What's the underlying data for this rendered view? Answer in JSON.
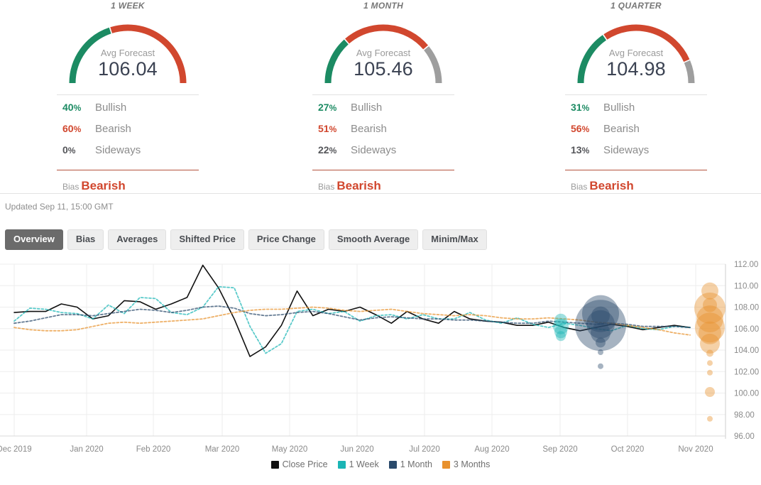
{
  "panels": [
    {
      "title": "1 WEEK",
      "gauge_label": "Avg Forecast",
      "gauge_value": "106.04",
      "bullish": "40",
      "bearish": "60",
      "sideways": "0",
      "bullish_label": "Bullish",
      "bearish_label": "Bearish",
      "sideways_label": "Sideways",
      "bias_label": "Bias",
      "bias_value": "Bearish"
    },
    {
      "title": "1 MONTH",
      "gauge_label": "Avg Forecast",
      "gauge_value": "105.46",
      "bullish": "27",
      "bearish": "51",
      "sideways": "22",
      "bullish_label": "Bullish",
      "bearish_label": "Bearish",
      "sideways_label": "Sideways",
      "bias_label": "Bias",
      "bias_value": "Bearish"
    },
    {
      "title": "1 QUARTER",
      "gauge_label": "Avg Forecast",
      "gauge_value": "104.98",
      "bullish": "31",
      "bearish": "56",
      "sideways": "13",
      "bullish_label": "Bullish",
      "bearish_label": "Bearish",
      "sideways_label": "Sideways",
      "bias_label": "Bias",
      "bias_value": "Bearish"
    }
  ],
  "updated_text": "Updated Sep 11, 15:00 GMT",
  "tabs": [
    {
      "label": "Overview",
      "active": true
    },
    {
      "label": "Bias",
      "active": false
    },
    {
      "label": "Averages",
      "active": false
    },
    {
      "label": "Shifted Price",
      "active": false
    },
    {
      "label": "Price Change",
      "active": false
    },
    {
      "label": "Smooth Average",
      "active": false
    },
    {
      "label": "Minim/Max",
      "active": false
    }
  ],
  "colors": {
    "bullish_green": "#1c8b63",
    "bearish_red": "#d1472e",
    "sideways_gray": "#9e9e9e",
    "close_price": "#111111",
    "one_week": "#1bb5b5",
    "one_month": "#2a4a6b",
    "three_months": "#e8912d",
    "tab_active_bg": "#6b6b6b",
    "tab_bg": "#eeeeee",
    "grid": "#ededed"
  },
  "chart_data": {
    "type": "line",
    "title": "",
    "xlabel": "",
    "ylabel": "",
    "ylim": [
      96.0,
      112.0
    ],
    "y_ticks": [
      "96.00",
      "98.00",
      "100.00",
      "102.00",
      "104.00",
      "106.00",
      "108.00",
      "110.00",
      "112.00"
    ],
    "y_tick_values": [
      96,
      98,
      100,
      102,
      104,
      106,
      108,
      110,
      112
    ],
    "x_ticks": [
      "Dec 2019",
      "Jan 2020",
      "Feb 2020",
      "Mar 2020",
      "May 2020",
      "Jun 2020",
      "Jul 2020",
      "Aug 2020",
      "Sep 2020",
      "Oct 2020",
      "Nov 2020"
    ],
    "grid": true,
    "legend_position": "bottom",
    "legend": [
      {
        "name": "Close Price",
        "color": "#111111",
        "style": "solid"
      },
      {
        "name": "1 Week",
        "color": "#1bb5b5",
        "style": "dashed"
      },
      {
        "name": "1 Month",
        "color": "#2a4a6b",
        "style": "dashed"
      },
      {
        "name": "3 Months",
        "color": "#e8912d",
        "style": "dashed"
      }
    ],
    "series": [
      {
        "name": "Close Price",
        "color": "#111111",
        "style": "solid",
        "values": [
          107.5,
          107.6,
          107.6,
          108.3,
          108.0,
          106.9,
          107.2,
          108.6,
          108.5,
          107.8,
          108.3,
          108.9,
          111.9,
          109.8,
          106.9,
          103.4,
          104.3,
          106.3,
          109.5,
          107.2,
          107.8,
          107.6,
          108.0,
          107.3,
          106.5,
          107.6,
          106.9,
          106.5,
          107.6,
          106.9,
          106.7,
          106.6,
          106.3,
          106.3,
          106.6,
          106.1,
          105.8,
          106.1,
          106.4,
          106.2,
          105.9,
          106.1,
          106.3,
          106.1
        ]
      },
      {
        "name": "1 Week",
        "color": "#1bb5b5",
        "style": "dashed",
        "values": [
          106.7,
          107.9,
          107.8,
          107.5,
          107.4,
          106.9,
          108.2,
          107.4,
          108.9,
          108.8,
          107.5,
          107.3,
          108.0,
          109.9,
          109.8,
          106.2,
          103.7,
          104.6,
          107.6,
          107.8,
          107.4,
          107.6,
          106.7,
          107.2,
          107.3,
          106.9,
          107.3,
          106.9,
          106.9,
          107.5,
          106.8,
          106.5,
          107.0,
          106.4,
          106.1,
          106.5,
          106.3,
          106.0,
          105.8,
          106.3,
          106.0,
          105.9,
          106.2,
          106.1
        ]
      },
      {
        "name": "1 Month",
        "color": "#2a4a6b",
        "style": "dashed",
        "values": [
          106.5,
          106.7,
          107.0,
          107.3,
          107.3,
          107.2,
          107.4,
          107.6,
          107.8,
          107.7,
          107.5,
          107.7,
          108.0,
          108.1,
          107.9,
          107.4,
          107.2,
          107.3,
          107.5,
          107.6,
          107.4,
          107.1,
          106.8,
          107.0,
          107.1,
          107.0,
          106.9,
          106.9,
          106.8,
          106.8,
          106.7,
          106.6,
          106.5,
          106.5,
          106.7,
          106.6,
          106.5,
          106.4,
          106.5,
          106.4,
          106.2,
          106.2,
          106.2,
          106.1
        ]
      },
      {
        "name": "3 Months",
        "color": "#e8912d",
        "style": "dashed",
        "values": [
          106.1,
          105.9,
          105.8,
          105.8,
          105.9,
          106.2,
          106.5,
          106.6,
          106.5,
          106.6,
          106.7,
          106.8,
          106.9,
          107.2,
          107.5,
          107.7,
          107.8,
          107.8,
          107.9,
          108.0,
          107.9,
          107.7,
          107.6,
          107.7,
          107.8,
          107.6,
          107.4,
          107.3,
          107.2,
          107.3,
          107.2,
          107.0,
          106.9,
          106.9,
          107.0,
          106.9,
          106.8,
          106.6,
          106.5,
          106.3,
          106.1,
          105.9,
          105.6,
          105.4
        ]
      }
    ],
    "bubbles": [
      {
        "series": "1 Week",
        "color": "#1bb5b5",
        "x_label": "Sep 2020",
        "value": 106.8,
        "size": 9
      },
      {
        "series": "1 Week",
        "color": "#1bb5b5",
        "x_label": "Sep 2020",
        "value": 106.2,
        "size": 11
      },
      {
        "series": "1 Week",
        "color": "#1bb5b5",
        "x_label": "Sep 2020",
        "value": 105.7,
        "size": 9
      },
      {
        "series": "1 Week",
        "color": "#1bb5b5",
        "x_label": "Sep 2020",
        "value": 105.3,
        "size": 7
      },
      {
        "series": "1 Month",
        "color": "#2a4a6b",
        "x_label": "Sep 2020",
        "value": 107.4,
        "size": 26
      },
      {
        "series": "1 Month",
        "color": "#2a4a6b",
        "x_label": "Sep 2020",
        "value": 107.2,
        "size": 13
      },
      {
        "series": "1 Month",
        "color": "#2a4a6b",
        "x_label": "Sep 2020",
        "value": 106.3,
        "size": 36
      },
      {
        "series": "1 Month",
        "color": "#2a4a6b",
        "x_label": "Sep 2020",
        "value": 106.4,
        "size": 20
      },
      {
        "series": "1 Month",
        "color": "#2a4a6b",
        "x_label": "Sep 2020",
        "value": 105.6,
        "size": 14
      },
      {
        "series": "1 Month",
        "color": "#2a4a6b",
        "x_label": "Sep 2020",
        "value": 104.7,
        "size": 7
      },
      {
        "series": "1 Month",
        "color": "#2a4a6b",
        "x_label": "Sep 2020",
        "value": 103.8,
        "size": 4
      },
      {
        "series": "1 Month",
        "color": "#2a4a6b",
        "x_label": "Sep 2020",
        "value": 102.5,
        "size": 4
      },
      {
        "series": "3 Months",
        "color": "#e8912d",
        "x_label": "Nov 2020",
        "value": 109.5,
        "size": 12
      },
      {
        "series": "3 Months",
        "color": "#e8912d",
        "x_label": "Nov 2020",
        "value": 107.9,
        "size": 22
      },
      {
        "series": "3 Months",
        "color": "#e8912d",
        "x_label": "Nov 2020",
        "value": 108.2,
        "size": 10
      },
      {
        "series": "3 Months",
        "color": "#e8912d",
        "x_label": "Nov 2020",
        "value": 106.9,
        "size": 19
      },
      {
        "series": "3 Months",
        "color": "#e8912d",
        "x_label": "Nov 2020",
        "value": 106.1,
        "size": 21
      },
      {
        "series": "3 Months",
        "color": "#e8912d",
        "x_label": "Nov 2020",
        "value": 105.6,
        "size": 16
      },
      {
        "series": "3 Months",
        "color": "#e8912d",
        "x_label": "Nov 2020",
        "value": 104.6,
        "size": 14
      },
      {
        "series": "3 Months",
        "color": "#e8912d",
        "x_label": "Nov 2020",
        "value": 103.7,
        "size": 5
      },
      {
        "series": "3 Months",
        "color": "#e8912d",
        "x_label": "Nov 2020",
        "value": 102.8,
        "size": 4
      },
      {
        "series": "3 Months",
        "color": "#e8912d",
        "x_label": "Nov 2020",
        "value": 101.9,
        "size": 4
      },
      {
        "series": "3 Months",
        "color": "#e8912d",
        "x_label": "Nov 2020",
        "value": 100.1,
        "size": 7
      },
      {
        "series": "3 Months",
        "color": "#e8912d",
        "x_label": "Nov 2020",
        "value": 97.6,
        "size": 4
      }
    ]
  }
}
